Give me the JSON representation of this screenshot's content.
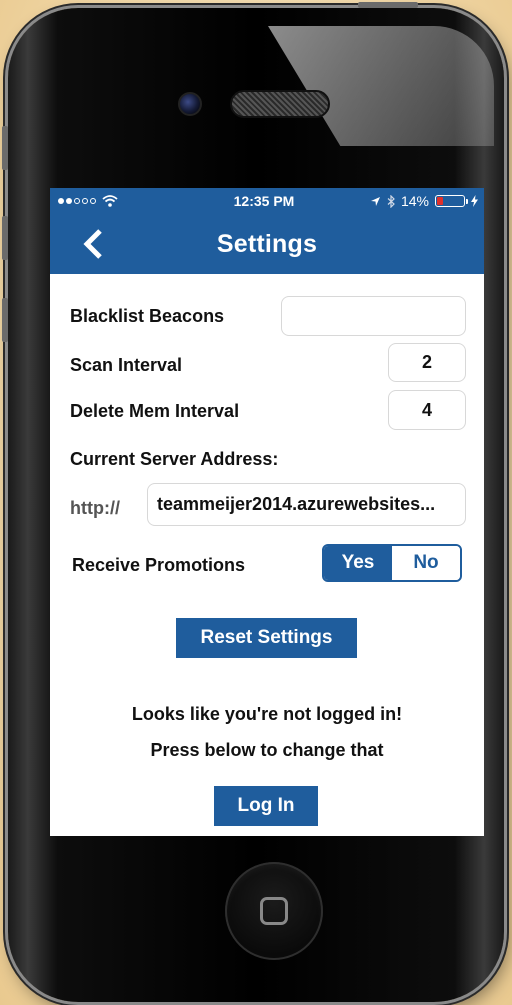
{
  "statusbar": {
    "time": "12:35 PM",
    "battery_text": "14%",
    "battery_level": 0.14,
    "icons": [
      "signal-dots-icon",
      "wifi-icon",
      "location-arrow-icon",
      "bluetooth-icon",
      "battery-icon",
      "charging-bolt-icon"
    ]
  },
  "navbar": {
    "title": "Settings",
    "back_icon": "chevron-left-icon"
  },
  "settings": {
    "blacklist_label": "Blacklist Beacons",
    "blacklist_value": "",
    "scan_label": "Scan Interval",
    "scan_value": "2",
    "delete_label": "Delete Mem Interval",
    "delete_value": "4",
    "server_label": "Current Server Address:",
    "server_prefix": "http://",
    "server_value": "teammeijer2014.azurewebsites...",
    "promotions_label": "Receive Promotions",
    "promotions_yes": "Yes",
    "promotions_no": "No",
    "reset_label": "Reset Settings"
  },
  "login": {
    "message_1": "Looks like you're not logged in!",
    "message_2": "Press below to change that",
    "button_label": "Log In"
  },
  "colors": {
    "accent": "#1f5d9d",
    "background": "#ffffff",
    "battery_low": "#e0302b"
  }
}
